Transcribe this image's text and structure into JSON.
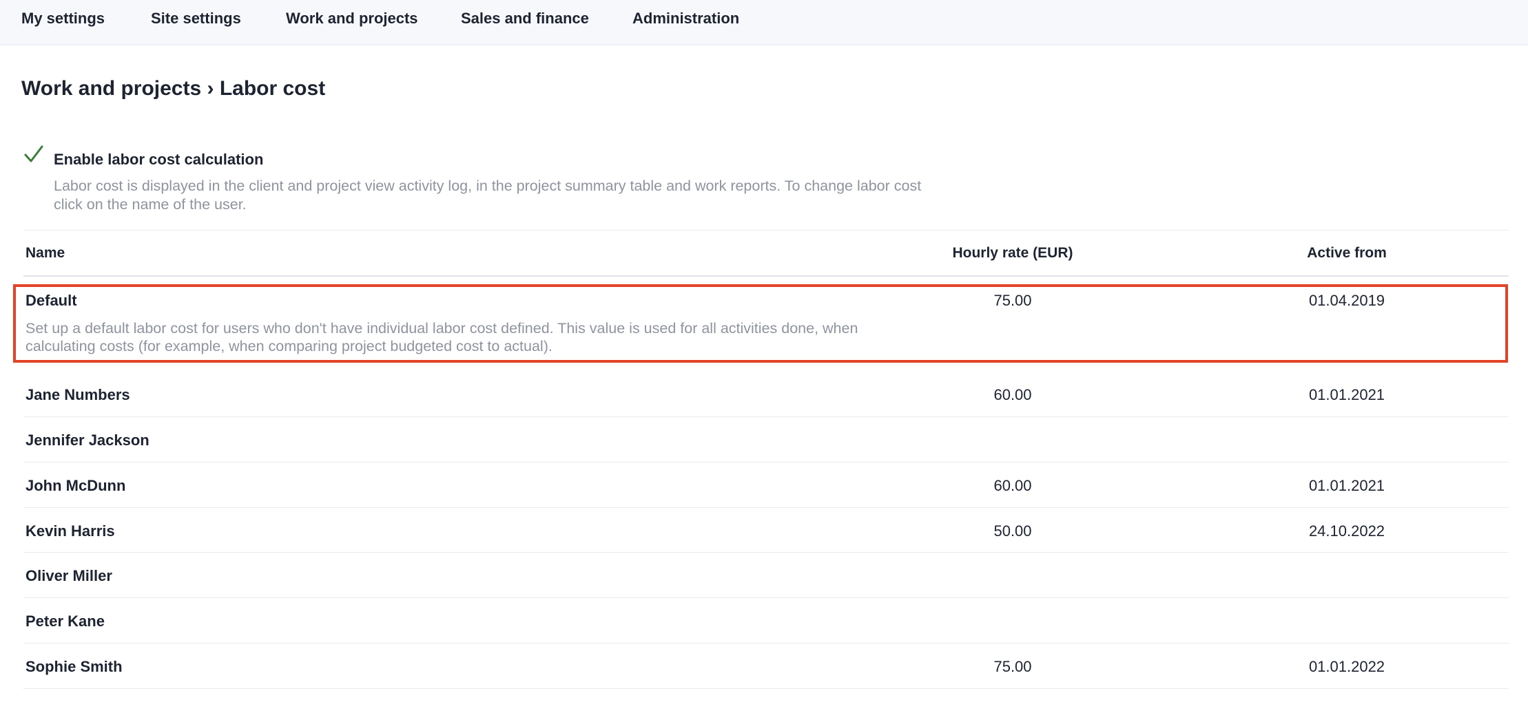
{
  "nav": {
    "items": [
      {
        "label": "My settings"
      },
      {
        "label": "Site settings"
      },
      {
        "label": "Work and projects"
      },
      {
        "label": "Sales and finance"
      },
      {
        "label": "Administration"
      }
    ]
  },
  "page": {
    "title": "Work and projects › Labor cost"
  },
  "labor_cost_setting": {
    "checked": true,
    "label": "Enable labor cost calculation",
    "description": "Labor cost is displayed in the client and project view activity log, in the project summary table and work reports. To change labor cost click on the name of the user."
  },
  "table": {
    "columns": [
      "Name",
      "Hourly rate (EUR)",
      "Active from"
    ],
    "default_row": {
      "name": "Default",
      "rate": "75.00",
      "active_from": "01.04.2019",
      "description": "Set up a default labor cost for users who don't have individual labor cost defined. This value is used for all activities done, when calculating costs (for example, when comparing project budgeted cost to actual).",
      "highlighted": true
    },
    "rows": [
      {
        "name": "Jane Numbers",
        "rate": "60.00",
        "active_from": "01.01.2021"
      },
      {
        "name": "Jennifer Jackson",
        "rate": "",
        "active_from": ""
      },
      {
        "name": "John McDunn",
        "rate": "60.00",
        "active_from": "01.01.2021"
      },
      {
        "name": "Kevin Harris",
        "rate": "50.00",
        "active_from": "24.10.2022"
      },
      {
        "name": "Oliver Miller",
        "rate": "",
        "active_from": ""
      },
      {
        "name": "Peter Kane",
        "rate": "",
        "active_from": ""
      },
      {
        "name": "Sophie Smith",
        "rate": "75.00",
        "active_from": "01.01.2022"
      }
    ]
  },
  "colors": {
    "highlight": "#e34427",
    "check": "#3a7d3a",
    "muted_text": "#8e949e",
    "nav_background": "#f7f8fb"
  },
  "icons": {
    "checkbox": "checkmark-icon"
  }
}
